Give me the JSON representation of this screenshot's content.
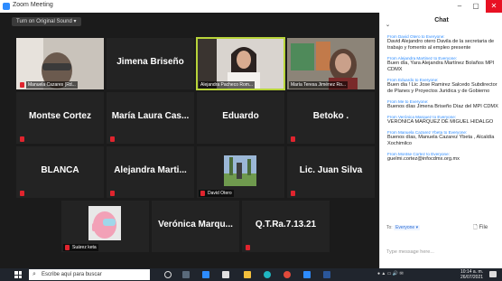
{
  "window": {
    "title": "Zoom Meeting",
    "minimize": "–",
    "maximize": "▢",
    "close": "✕"
  },
  "meeting": {
    "sound_button": "Turn on Original Sound"
  },
  "tiles": {
    "t1": {
      "label": "Manuela Cazares (Rd..."
    },
    "t2": {
      "name": "Jimena Briseño"
    },
    "t3": {
      "label": "Alejandra Pacheco Rom..."
    },
    "t4": {
      "label": "María Teresa Jiménez Ro..."
    },
    "t5": {
      "name": "Montse Cortez"
    },
    "t6": {
      "name": "María Laura Cas..."
    },
    "t7": {
      "name": "Eduardo"
    },
    "t8": {
      "name": "Betoko ."
    },
    "t9": {
      "name": "BLANCA"
    },
    "t10": {
      "name": "Alejandra Marti..."
    },
    "t11": {
      "label": "David Otero"
    },
    "t12": {
      "name": "Lic. Juan Silva"
    },
    "t13": {
      "label": "Suárez keta"
    },
    "t14": {
      "name": "Verónica Marqu..."
    },
    "t15": {
      "name": "Q.T.Ra.7.13.21"
    }
  },
  "chat": {
    "title": "Chat",
    "messages": [
      {
        "from": "From David Otero to Everyone:",
        "text": "David Alejandro otero Davila de la secretaria de trabajo y fomento al empleo presente"
      },
      {
        "from": "From Alejandra Martinez to Everyone:",
        "text": "Buen día, Yara Alejandra Martínez Bolaños MPI CDMX"
      },
      {
        "from": "From Eduardo to Everyone:",
        "text": "Buen dia ! Lic Jose Ramirez Salcedo Subdirector de Planes y Proyectos Juridica y de Gobierno"
      },
      {
        "from": "From Me to Everyone:",
        "text": "Buenos días Jimena Briseño Díaz del MPI CDMX"
      },
      {
        "from": "From Verónica Marquez to Everyone:",
        "text": "VERONICA MARQUEZ DE MIGUEL HIDALGO"
      },
      {
        "from": "From Manuela Cazarez Ybeta to Everyone:",
        "text": "Buenos días, Manuela Cazarez Ybeta , Alcaldía Xochimilco"
      },
      {
        "from": "From Montse Cortez to Everyone:",
        "text": "guelmi.cortez@infocdmx.org.mx"
      }
    ],
    "to_label": "To:",
    "to_value": "Everyone ▾",
    "file_label": "File",
    "input_placeholder": "Type message here..."
  },
  "taskbar": {
    "search_placeholder": "Escribe aquí para buscar",
    "time": "10:14 a. m.",
    "date": "26/07/2021"
  },
  "colors": {
    "accent": "#2d8cff",
    "selected_border": "#b8d43a",
    "mic_off": "#e0242e"
  }
}
